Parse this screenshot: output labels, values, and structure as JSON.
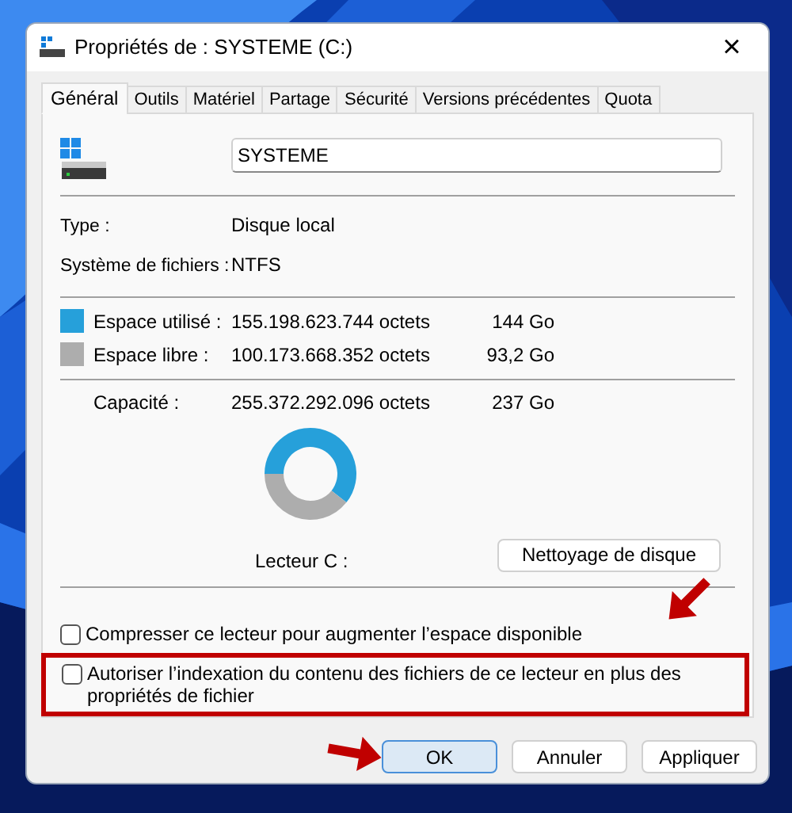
{
  "window": {
    "title": "Propriétés de : SYSTEME (C:)",
    "close": "×"
  },
  "tabs": [
    {
      "label": "Général",
      "selected": true
    },
    {
      "label": "Outils",
      "selected": false
    },
    {
      "label": "Matériel",
      "selected": false
    },
    {
      "label": "Partage",
      "selected": false
    },
    {
      "label": "Sécurité",
      "selected": false
    },
    {
      "label": "Versions précédentes",
      "selected": false
    },
    {
      "label": "Quota",
      "selected": false
    }
  ],
  "name_field": {
    "value": "SYSTEME"
  },
  "info": [
    {
      "label": "Type :",
      "value": "Disque local"
    },
    {
      "label": "Système de fichiers :",
      "value": "NTFS"
    }
  ],
  "space": [
    {
      "label": "Espace utilisé :",
      "bytes": "155.198.623.744 octets",
      "size": "144 Go",
      "color": "#26a0da"
    },
    {
      "label": "Espace libre :",
      "bytes": "100.173.668.352 octets",
      "size": "93,2 Go",
      "color": "#adadad"
    }
  ],
  "capacity": {
    "label": "Capacité :",
    "bytes": "255.372.292.096 octets",
    "size": "237 Go"
  },
  "usage": {
    "chart_data": {
      "type": "donut",
      "values": [
        60.7,
        39.3
      ]
    }
  },
  "drive_label": "Lecteur C :",
  "cleanup_button": "Nettoyage de disque",
  "options": [
    {
      "label": "Compresser ce lecteur pour augmenter l’espace disponible",
      "checked": false,
      "highlighted": false
    },
    {
      "label": "Autoriser l’indexation du contenu des fichiers de ce lecteur en plus des propriétés de fichier",
      "checked": false,
      "highlighted": true
    }
  ],
  "buttons": [
    {
      "label": "OK",
      "selected": true
    },
    {
      "label": "Annuler",
      "selected": false
    },
    {
      "label": "Appliquer",
      "selected": false
    }
  ]
}
